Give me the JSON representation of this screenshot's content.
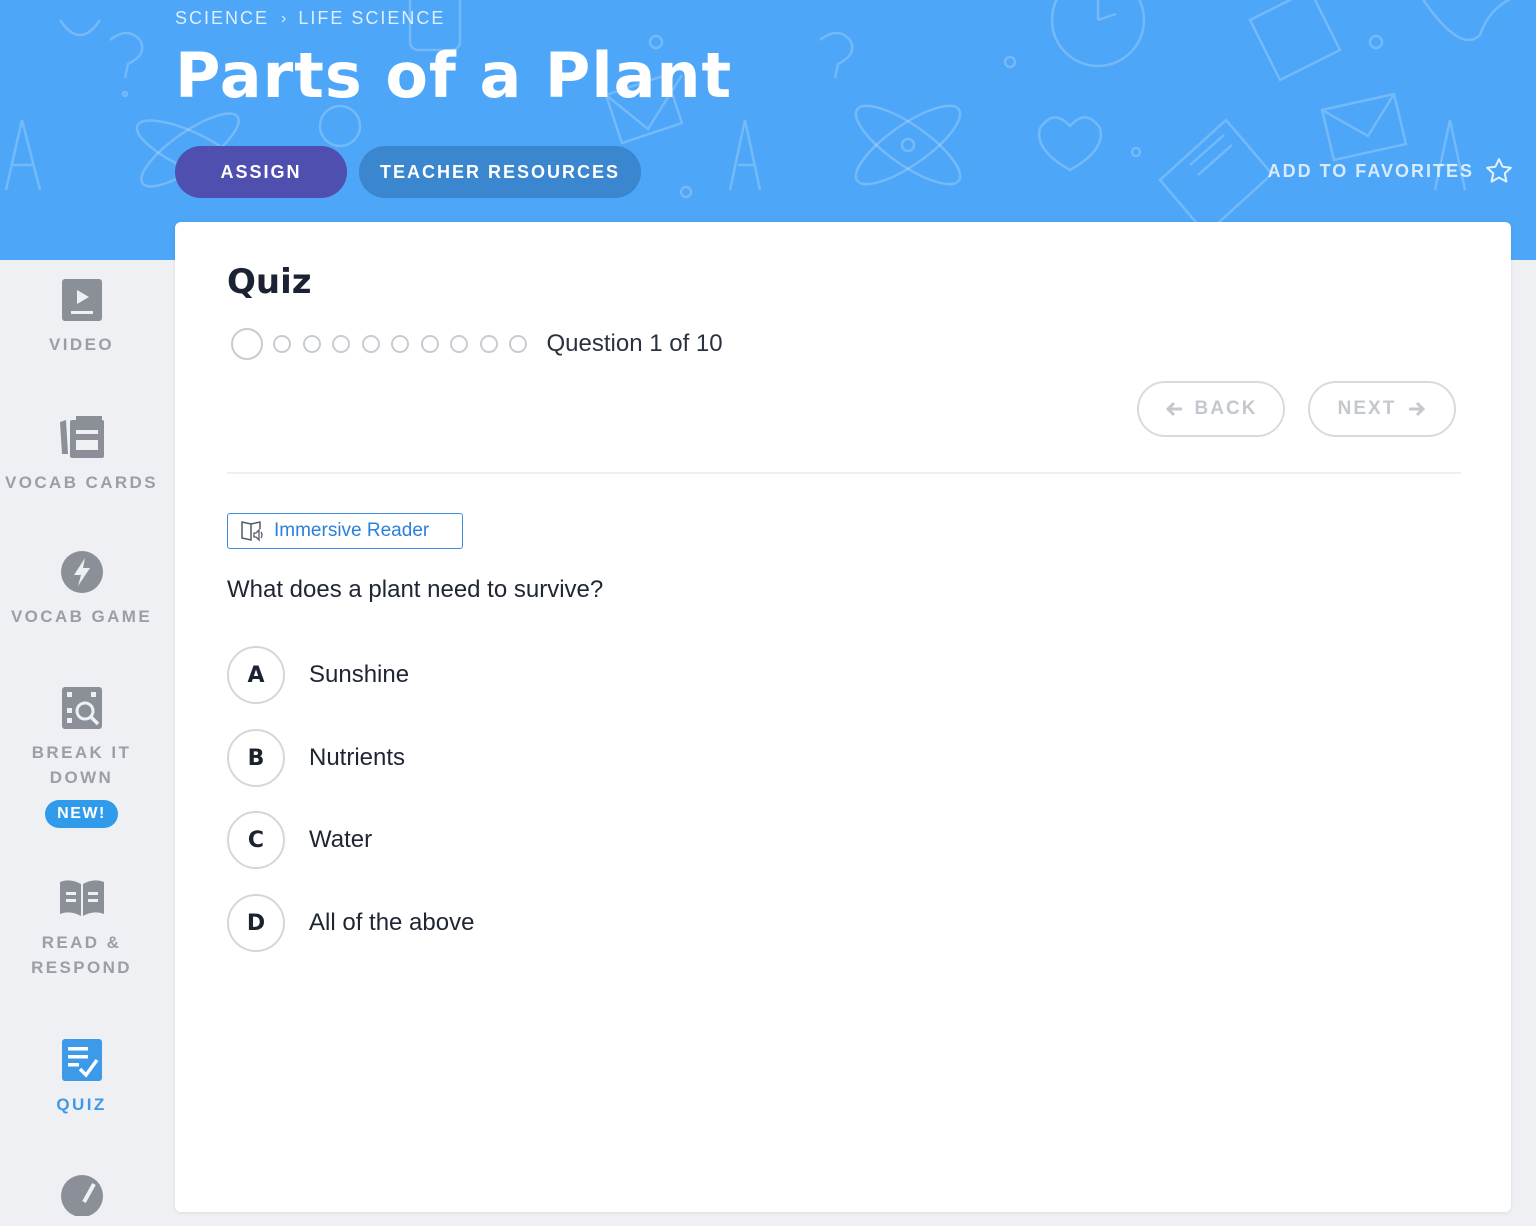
{
  "header": {
    "breadcrumb": [
      "SCIENCE",
      "LIFE SCIENCE"
    ],
    "breadcrumb_separator": "›",
    "title": "Parts of a Plant",
    "assign_label": "ASSIGN",
    "teacher_resources_label": "TEACHER RESOURCES",
    "favorites_label": "ADD TO FAVORITES",
    "background_color": "#4da6f7"
  },
  "sidebar": {
    "items": [
      {
        "label": "VIDEO",
        "icon": "video-icon"
      },
      {
        "label": "VOCAB CARDS",
        "icon": "vocab-cards-icon"
      },
      {
        "label": "VOCAB GAME",
        "icon": "lightning-icon"
      },
      {
        "label_line1": "BREAK IT",
        "label_line2": "DOWN",
        "badge": "NEW!",
        "icon": "magnifier-icon"
      },
      {
        "label_line1": "READ &",
        "label_line2": "RESPOND",
        "icon": "open-book-icon"
      },
      {
        "label": "QUIZ",
        "icon": "quiz-icon",
        "active": true
      }
    ],
    "active_color": "#3d9ae9"
  },
  "quiz": {
    "title": "Quiz",
    "progress_text": "Question 1 of 10",
    "current_question": 1,
    "total_questions": 10,
    "back_label": "BACK",
    "next_label": "NEXT",
    "immersive_reader_label": "Immersive Reader",
    "question": "What does a plant need to survive?",
    "answers": [
      {
        "letter": "A",
        "text": "Sunshine"
      },
      {
        "letter": "B",
        "text": "Nutrients"
      },
      {
        "letter": "C",
        "text": "Water"
      },
      {
        "letter": "D",
        "text": "All of the above"
      }
    ]
  }
}
